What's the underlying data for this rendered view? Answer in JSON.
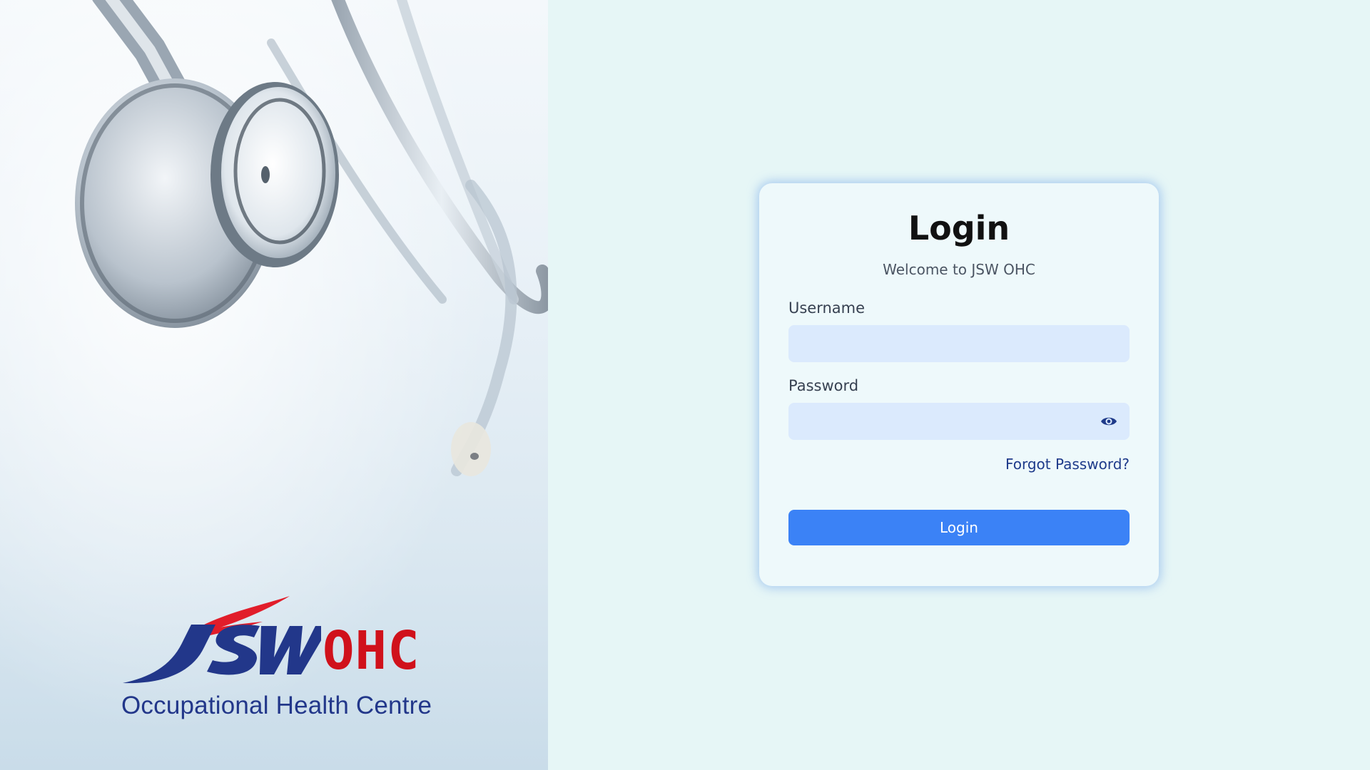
{
  "brand": {
    "wordmark": "JSW",
    "suffix": "OHC",
    "tagline": "Occupational Health Centre",
    "colors": {
      "blue": "#22378a",
      "red": "#d0111b"
    }
  },
  "hero": {
    "image": "stethoscope-photo"
  },
  "login": {
    "title": "Login",
    "subtitle": "Welcome to JSW OHC",
    "username_label": "Username",
    "username_value": "",
    "password_label": "Password",
    "password_value": "",
    "forgot_password": "Forgot Password?",
    "submit_label": "Login",
    "icons": {
      "password_toggle": "eye-icon"
    },
    "colors": {
      "accent": "#3b82f6",
      "input_bg": "#dbeafd",
      "link": "#1e3a8a"
    }
  }
}
